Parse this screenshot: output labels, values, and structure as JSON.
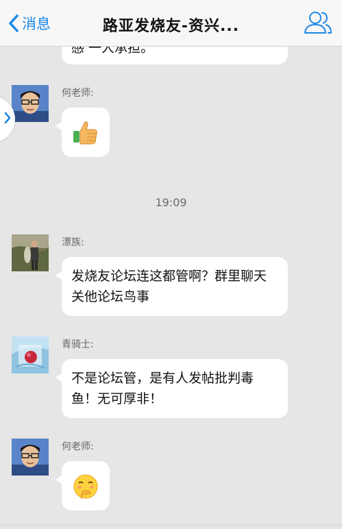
{
  "navbar": {
    "back_label": "消息",
    "title": "路亚发烧友-资兴..."
  },
  "chat": {
    "partial_message_text": "感 一人承担。",
    "messages": [
      {
        "sender": "何老师:",
        "content": "👍",
        "avatar": "avatar-he-laoshi"
      },
      {
        "sender": "漂族:",
        "content": "发烧友论坛连这都管啊？群里聊天关他论坛鸟事",
        "avatar": "avatar-piaozu"
      },
      {
        "sender": "青骑士:",
        "content": "不是论坛管，是有人发帖批判毒鱼！无可厚非！",
        "avatar": "avatar-qingqishi"
      },
      {
        "sender": "何老师:",
        "content": "🤭",
        "avatar": "avatar-he-laoshi"
      }
    ],
    "timestamp": "19:09"
  },
  "icons": {
    "back": "chevron-left-icon",
    "group": "group-members-icon",
    "side_tab": "chevron-right-icon",
    "thumbs_up": "thumbs-up-emoji",
    "shy": "shy-face-emoji"
  },
  "colors": {
    "accent": "#1a88e6",
    "background": "#e6e6e6",
    "bubble": "#ffffff"
  }
}
